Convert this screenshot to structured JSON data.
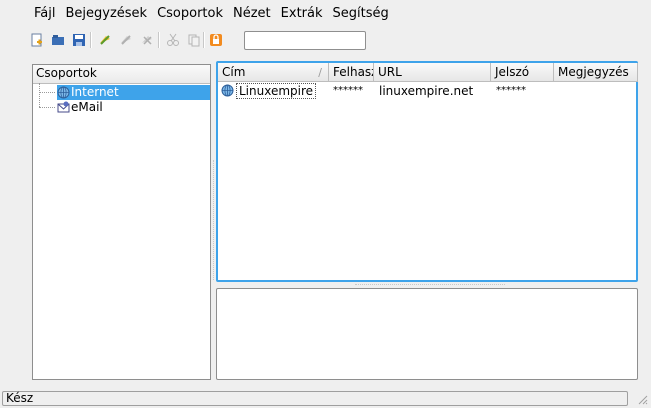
{
  "menubar": {
    "items": [
      {
        "label": "Fájl"
      },
      {
        "label": "Bejegyzések"
      },
      {
        "label": "Csoportok"
      },
      {
        "label": "Nézet"
      },
      {
        "label": "Extrák"
      },
      {
        "label": "Segítség"
      }
    ]
  },
  "toolbar": {
    "buttons": [
      "new-file-icon",
      "open-folder-icon",
      "save-icon",
      "add-entry-icon",
      "edit-entry-icon",
      "delete-entry-icon",
      "cut-icon",
      "copy-icon",
      "lock-icon"
    ],
    "search_value": ""
  },
  "tree": {
    "header": "Csoportok",
    "items": [
      {
        "label": "Internet",
        "icon": "globe-icon",
        "selected": true
      },
      {
        "label": "eMail",
        "icon": "email-icon",
        "selected": false
      }
    ]
  },
  "table": {
    "columns": [
      "Cím",
      "Felhasználónév",
      "URL",
      "Jelszó",
      "Megjegyzés"
    ],
    "rows": [
      {
        "title": "Linuxempire",
        "username": "******",
        "url": "linuxempire.net",
        "password": "******",
        "comment": ""
      }
    ]
  },
  "status": {
    "text": "Kész"
  },
  "colors": {
    "selection": "#3ea3ea"
  }
}
